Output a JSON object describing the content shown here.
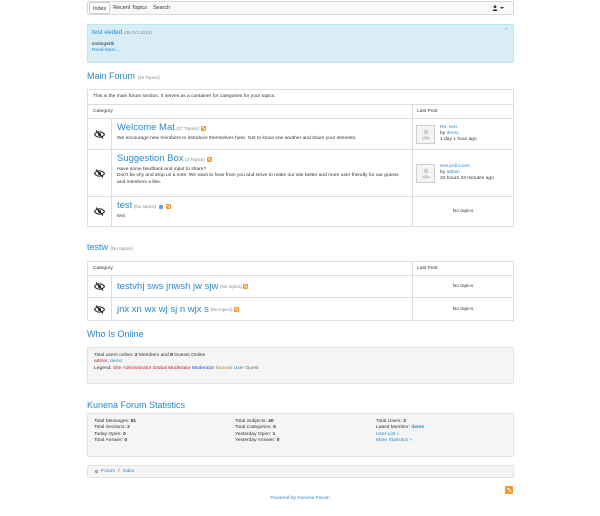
{
  "nav": {
    "tabs": [
      "Index",
      "Recent Topics",
      "Search"
    ],
    "user_icon": "user-icon"
  },
  "announcement": {
    "title": "test eeded",
    "date": "(06 Oct 2013)",
    "text": "testingsklk",
    "more": "Read More...",
    "close": "×"
  },
  "main_forum": {
    "title": "Main Forum",
    "count": "(40 Topics)",
    "description": "This is the main forum section. It serves as a container for categories for your topics.",
    "col_category": "Category",
    "col_last_post": "Last Post",
    "categories": [
      {
        "title": "Welcome Mat",
        "count": "(37 Topics)",
        "desc": "We encourage new members to introduce themselves here. Get to know one another and share your interests.",
        "last_title": "Re: test",
        "last_by": "by",
        "last_user": "demo",
        "last_time": "1 day 1 hour ago"
      },
      {
        "title": "Suggestion Box",
        "count": "(3 Topics)",
        "desc1": "Have some feedback and input to share?",
        "desc2": "Don't be shy and drop us a note. We want to hear from you and strive to make our site better and more user friendly for our guests and members a like.",
        "last_title": "test poll icons",
        "last_by": "by",
        "last_user": "admin",
        "last_time": "22 hours 33 minutes ago"
      },
      {
        "title": "test",
        "count": "(No topics)",
        "desc": "test",
        "last_none": "No topics"
      }
    ]
  },
  "testw": {
    "title": "testw",
    "count": "(No topics)",
    "col_category": "Category",
    "col_last_post": "Last Post",
    "categories": [
      {
        "title": "testvhj sws jnwsh jw sjw",
        "count": "(No topics)",
        "last_none": "No topics"
      },
      {
        "title": "jnx xn wx wj sj n wjx s",
        "count": "(No topics)",
        "last_none": "No topics"
      }
    ]
  },
  "online": {
    "title": "Who Is Online",
    "line1_a": "Total users online: ",
    "members": "2",
    "line1_b": " Members and ",
    "guests": "8",
    "line1_c": " Guests Online",
    "user1": "admin",
    "sep": ", ",
    "user2": "demo",
    "legend_label": "Legend: ",
    "legend_sa": "Site Administrator",
    "legend_gm": "Global Moderator",
    "legend_mod": "Moderator",
    "legend_banned": "Banned",
    "legend_user": "User",
    "legend_guest": "Guest"
  },
  "stats": {
    "title": "Kunena Forum Statistics",
    "col1": [
      {
        "label": "Total Messages: ",
        "value": "81"
      },
      {
        "label": "Total Sections: ",
        "value": "2"
      },
      {
        "label": "Today Open: ",
        "value": "0"
      },
      {
        "label": "Total Answer: ",
        "value": "0"
      }
    ],
    "col2": [
      {
        "label": "Total Subjects: ",
        "value": "40"
      },
      {
        "label": "Total Categories: ",
        "value": "5"
      },
      {
        "label": "Yesterday Open: ",
        "value": "1"
      },
      {
        "label": "Yesterday Answer: ",
        "value": "0"
      }
    ],
    "col3_total_users_label": "Total Users: ",
    "col3_total_users": "2",
    "col3_latest_label": "Latest Member: ",
    "col3_latest": "demo",
    "col3_userlist": "User List »",
    "col3_more": "More Statistics »"
  },
  "breadcrumb": {
    "forum": "Forum",
    "sep": " / ",
    "index": "Index"
  },
  "footer": {
    "powered": "Powered by Kunena Forum"
  },
  "colors": {
    "link": "#2a8ac9",
    "announce_bg": "#d9edf7",
    "rss": "#f39c2c"
  }
}
